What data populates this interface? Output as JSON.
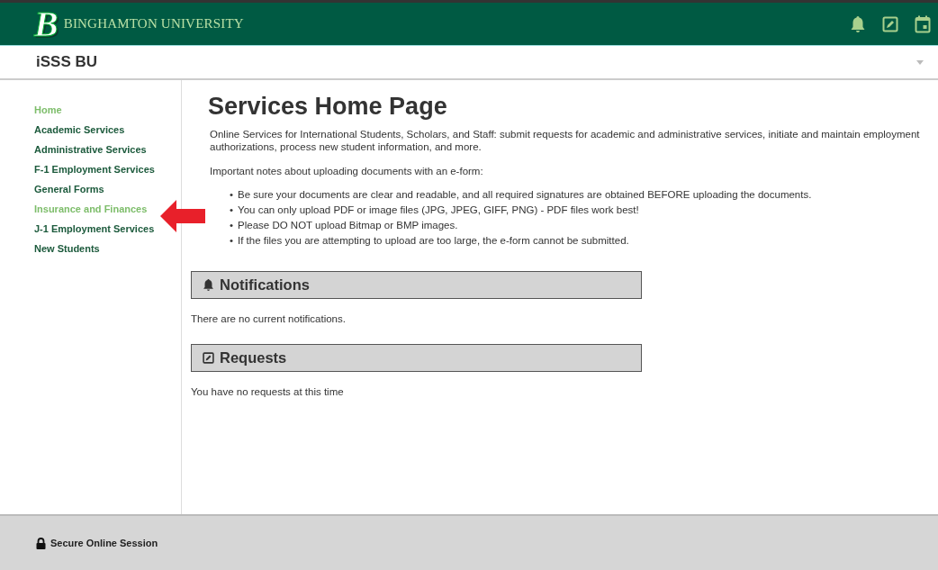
{
  "header": {
    "brand": "BINGHAMTON UNIVERSITY",
    "logo_letter": "B"
  },
  "subheader": {
    "title": "iSSS BU"
  },
  "sidebar": {
    "items": [
      {
        "label": "Home",
        "selected": true
      },
      {
        "label": "Academic Services",
        "selected": false
      },
      {
        "label": "Administrative Services",
        "selected": false
      },
      {
        "label": "F-1 Employment Services",
        "selected": false
      },
      {
        "label": "General Forms",
        "selected": false
      },
      {
        "label": "Insurance and Finances",
        "selected": true
      },
      {
        "label": "J-1 Employment Services",
        "selected": false
      },
      {
        "label": "New Students",
        "selected": false
      }
    ]
  },
  "main": {
    "title": "Services Home Page",
    "intro": "Online Services for International Students, Scholars, and Staff: submit requests for academic and administrative services, initiate and maintain employment authorizations, process new student information, and more.",
    "notes_heading": "Important notes about uploading documents with an e-form:",
    "bullet": "•",
    "notes": [
      "Be sure your documents are clear and readable, and all required signatures are obtained BEFORE uploading the documents.",
      "You can only upload PDF or image files (JPG, JPEG, GIFF, PNG) - PDF files work best!",
      "Please DO NOT upload Bitmap or BMP images.",
      "If the files you are attempting to upload are too large, the e-form cannot be submitted."
    ],
    "sections": [
      {
        "kind": "notifications",
        "title": "Notifications",
        "message": "There are no current notifications."
      },
      {
        "kind": "requests",
        "title": "Requests",
        "message": "You have no requests at this time"
      }
    ]
  },
  "footer": {
    "text": "Secure Online Session"
  }
}
